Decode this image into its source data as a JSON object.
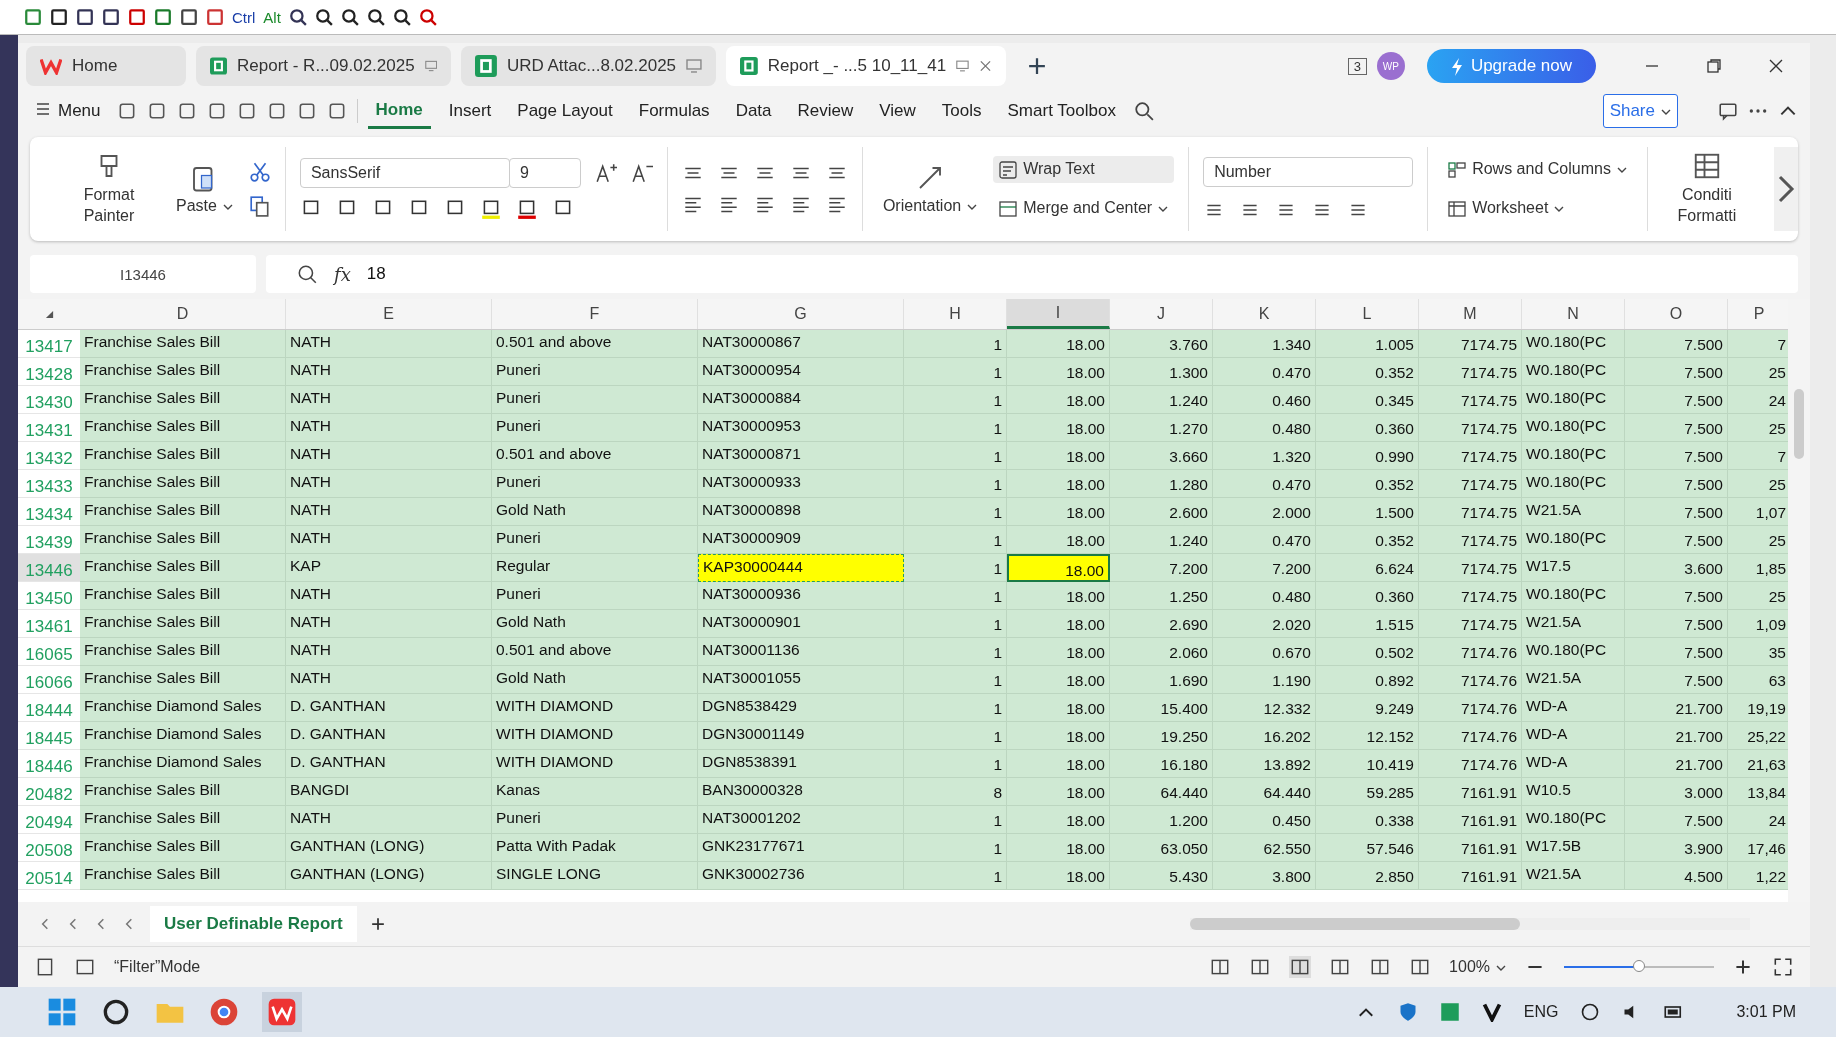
{
  "toolbar": {
    "labels": [
      "Ctrl",
      "Alt"
    ]
  },
  "tabs": [
    {
      "label": "Home",
      "kind": "home",
      "selected": false
    },
    {
      "label": "Report - R...09.02.2025",
      "kind": "sheet",
      "selected": false
    },
    {
      "label": "URD Attac...8.02.2025",
      "kind": "sheet",
      "selected": false
    },
    {
      "label": "Report _- ...5 10_11_41",
      "kind": "sheet",
      "selected": true
    }
  ],
  "title_bar": {
    "badge": "3",
    "avatar": "WP",
    "upgrade": "Upgrade now"
  },
  "menu": {
    "label": "Menu",
    "share": "Share",
    "tabs": [
      {
        "label": "Home",
        "selected": true
      },
      {
        "label": "Insert",
        "selected": false
      },
      {
        "label": "Page Layout",
        "selected": false
      },
      {
        "label": "Formulas",
        "selected": false
      },
      {
        "label": "Data",
        "selected": false
      },
      {
        "label": "Review",
        "selected": false
      },
      {
        "label": "View",
        "selected": false
      },
      {
        "label": "Tools",
        "selected": false
      },
      {
        "label": "Smart Toolbox",
        "selected": false
      }
    ]
  },
  "ribbon": {
    "format_painter": "Format Painter",
    "paste": "Paste",
    "font": "SansSerif",
    "font_size": "9",
    "orientation": "Orientation",
    "wrap_text": "Wrap Text",
    "merge": "Merge and Center",
    "number_format": "Number",
    "rows_columns": "Rows and Columns",
    "worksheet": "Worksheet",
    "conditional": "Conditi Formatti"
  },
  "formula_bar": {
    "cell": "I13446",
    "fx": "fx",
    "value": "18"
  },
  "columns": [
    {
      "label": "D",
      "kind": "text",
      "selected": false
    },
    {
      "label": "E",
      "kind": "text",
      "selected": false
    },
    {
      "label": "F",
      "kind": "text",
      "selected": false
    },
    {
      "label": "G",
      "kind": "text",
      "selected": false
    },
    {
      "label": "H",
      "kind": "number",
      "selected": false
    },
    {
      "label": "I",
      "kind": "number",
      "selected": true
    },
    {
      "label": "J",
      "kind": "number",
      "selected": false
    },
    {
      "label": "K",
      "kind": "number",
      "selected": false
    },
    {
      "label": "L",
      "kind": "number",
      "selected": false
    },
    {
      "label": "M",
      "kind": "number",
      "selected": false
    },
    {
      "label": "N",
      "kind": "text",
      "selected": false
    },
    {
      "label": "O",
      "kind": "number",
      "selected": false
    },
    {
      "label": "P",
      "kind": "number",
      "selected": false
    }
  ],
  "rows": [
    {
      "num": "13417",
      "selected": false,
      "cells": [
        "Franchise Sales Bill",
        "NATH",
        "0.501 and above",
        "NAT30000867",
        "1",
        "18.00",
        "3.760",
        "1.340",
        "1.005",
        "7174.75",
        "W0.180(PC",
        "7.500",
        "7"
      ]
    },
    {
      "num": "13428",
      "selected": false,
      "cells": [
        "Franchise Sales Bill",
        "NATH",
        "Puneri",
        "NAT30000954",
        "1",
        "18.00",
        "1.300",
        "0.470",
        "0.352",
        "7174.75",
        "W0.180(PC",
        "7.500",
        "25"
      ]
    },
    {
      "num": "13430",
      "selected": false,
      "cells": [
        "Franchise Sales Bill",
        "NATH",
        "Puneri",
        "NAT30000884",
        "1",
        "18.00",
        "1.240",
        "0.460",
        "0.345",
        "7174.75",
        "W0.180(PC",
        "7.500",
        "24"
      ]
    },
    {
      "num": "13431",
      "selected": false,
      "cells": [
        "Franchise Sales Bill",
        "NATH",
        "Puneri",
        "NAT30000953",
        "1",
        "18.00",
        "1.270",
        "0.480",
        "0.360",
        "7174.75",
        "W0.180(PC",
        "7.500",
        "25"
      ]
    },
    {
      "num": "13432",
      "selected": false,
      "cells": [
        "Franchise Sales Bill",
        "NATH",
        "0.501 and above",
        "NAT30000871",
        "1",
        "18.00",
        "3.660",
        "1.320",
        "0.990",
        "7174.75",
        "W0.180(PC",
        "7.500",
        "7"
      ]
    },
    {
      "num": "13433",
      "selected": false,
      "cells": [
        "Franchise Sales Bill",
        "NATH",
        "Puneri",
        "NAT30000933",
        "1",
        "18.00",
        "1.280",
        "0.470",
        "0.352",
        "7174.75",
        "W0.180(PC",
        "7.500",
        "25"
      ]
    },
    {
      "num": "13434",
      "selected": false,
      "cells": [
        "Franchise Sales Bill",
        "NATH",
        "Gold Nath",
        "NAT30000898",
        "1",
        "18.00",
        "2.600",
        "2.000",
        "1.500",
        "7174.75",
        "W21.5A",
        "7.500",
        "1,07"
      ]
    },
    {
      "num": "13439",
      "selected": false,
      "cells": [
        "Franchise Sales Bill",
        "NATH",
        "Puneri",
        "NAT30000909",
        "1",
        "18.00",
        "1.240",
        "0.470",
        "0.352",
        "7174.75",
        "W0.180(PC",
        "7.500",
        "25"
      ]
    },
    {
      "num": "13446",
      "selected": true,
      "cells": [
        "Franchise Sales Bill",
        "KAP",
        "Regular",
        {
          "text": "KAP30000444",
          "copied": true
        },
        "1",
        {
          "text": "18.00",
          "active": true
        },
        "7.200",
        "7.200",
        "6.624",
        "7174.75",
        "W17.5",
        "3.600",
        "1,85"
      ]
    },
    {
      "num": "13450",
      "selected": false,
      "cells": [
        "Franchise Sales Bill",
        "NATH",
        "Puneri",
        "NAT30000936",
        "1",
        "18.00",
        "1.250",
        "0.480",
        "0.360",
        "7174.75",
        "W0.180(PC",
        "7.500",
        "25"
      ]
    },
    {
      "num": "13461",
      "selected": false,
      "cells": [
        "Franchise Sales Bill",
        "NATH",
        "Gold Nath",
        "NAT30000901",
        "1",
        "18.00",
        "2.690",
        "2.020",
        "1.515",
        "7174.75",
        "W21.5A",
        "7.500",
        "1,09"
      ]
    },
    {
      "num": "16065",
      "selected": false,
      "cells": [
        "Franchise Sales Bill",
        "NATH",
        "0.501 and above",
        "NAT30001136",
        "1",
        "18.00",
        "2.060",
        "0.670",
        "0.502",
        "7174.76",
        "W0.180(PC",
        "7.500",
        "35"
      ]
    },
    {
      "num": "16066",
      "selected": false,
      "cells": [
        "Franchise Sales Bill",
        "NATH",
        "Gold Nath",
        "NAT30001055",
        "1",
        "18.00",
        "1.690",
        "1.190",
        "0.892",
        "7174.76",
        "W21.5A",
        "7.500",
        "63"
      ]
    },
    {
      "num": "18444",
      "selected": false,
      "cells": [
        "Franchise Diamond Sales",
        "D. GANTHAN",
        "WITH DIAMOND",
        "DGN8538429",
        "1",
        "18.00",
        "15.400",
        "12.332",
        "9.249",
        "7174.76",
        "WD-A",
        "21.700",
        "19,19"
      ]
    },
    {
      "num": "18445",
      "selected": false,
      "cells": [
        "Franchise Diamond Sales",
        "D. GANTHAN",
        "WITH DIAMOND",
        "DGN30001149",
        "1",
        "18.00",
        "19.250",
        "16.202",
        "12.152",
        "7174.76",
        "WD-A",
        "21.700",
        "25,22"
      ]
    },
    {
      "num": "18446",
      "selected": false,
      "cells": [
        "Franchise Diamond Sales",
        "D. GANTHAN",
        "WITH DIAMOND",
        "DGN8538391",
        "1",
        "18.00",
        "16.180",
        "13.892",
        "10.419",
        "7174.76",
        "WD-A",
        "21.700",
        "21,63"
      ]
    },
    {
      "num": "20482",
      "selected": false,
      "cells": [
        "Franchise Sales Bill",
        "BANGDI",
        "Kanas",
        "BAN30000328",
        "8",
        "18.00",
        "64.440",
        "64.440",
        "59.285",
        "7161.91",
        "W10.5",
        "3.000",
        "13,84"
      ]
    },
    {
      "num": "20494",
      "selected": false,
      "cells": [
        "Franchise Sales Bill",
        "NATH",
        "Puneri",
        "NAT30001202",
        "1",
        "18.00",
        "1.200",
        "0.450",
        "0.338",
        "7161.91",
        "W0.180(PC",
        "7.500",
        "24"
      ]
    },
    {
      "num": "20508",
      "selected": false,
      "cells": [
        "Franchise Sales Bill",
        "GANTHAN (LONG)",
        "Patta With Padak",
        "GNK23177671",
        "1",
        "18.00",
        "63.050",
        "62.550",
        "57.546",
        "7161.91",
        "W17.5B",
        "3.900",
        "17,46"
      ]
    },
    {
      "num": "20514",
      "selected": false,
      "cells": [
        "Franchise Sales Bill",
        "GANTHAN (LONG)",
        "SINGLE LONG",
        "GNK30002736",
        "1",
        "18.00",
        "5.430",
        "3.800",
        "2.850",
        "7161.91",
        "W21.5A",
        "4.500",
        "1,22"
      ]
    }
  ],
  "sheet_tabs": [
    {
      "label": "User Definable Report",
      "selected": true
    }
  ],
  "status_bar": {
    "mode": "“Filter”Mode",
    "zoom": "100%",
    "level": 0.5
  },
  "taskbar": {
    "language": "ENG",
    "time": "3:01 PM"
  }
}
